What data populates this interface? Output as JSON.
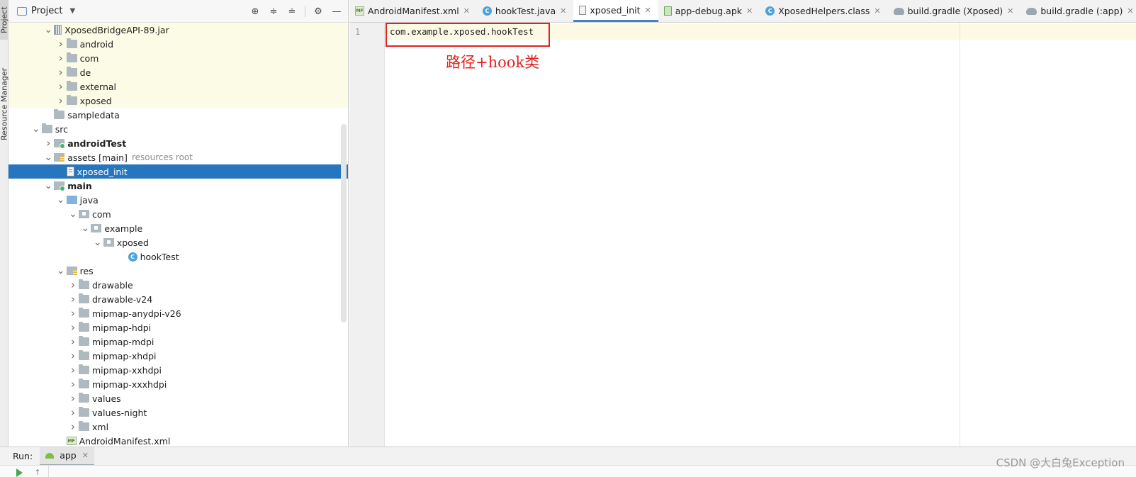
{
  "side_strip": {
    "project": "Project",
    "resource_manager": "Resource Manager"
  },
  "panel": {
    "title": "Project"
  },
  "tree": [
    {
      "label": "XposedBridgeAPI-89.jar",
      "depth": 3,
      "chevron": "down",
      "icon": "jar",
      "lib": true
    },
    {
      "label": "android",
      "depth": 4,
      "chevron": "right",
      "icon": "folder",
      "lib": true
    },
    {
      "label": "com",
      "depth": 4,
      "chevron": "right",
      "icon": "folder",
      "lib": true
    },
    {
      "label": "de",
      "depth": 4,
      "chevron": "right",
      "icon": "folder",
      "lib": true
    },
    {
      "label": "external",
      "depth": 4,
      "chevron": "right",
      "icon": "folder",
      "lib": true
    },
    {
      "label": "xposed",
      "depth": 4,
      "chevron": "right",
      "icon": "folder",
      "lib": true
    },
    {
      "label": "sampledata",
      "depth": 3,
      "chevron": "",
      "icon": "folder"
    },
    {
      "label": "src",
      "depth": 2,
      "chevron": "down",
      "icon": "folder"
    },
    {
      "label": "androidTest",
      "depth": 3,
      "chevron": "right",
      "icon": "folder-mod",
      "bold": true
    },
    {
      "label": "assets [main]",
      "depth": 3,
      "chevron": "down",
      "icon": "folder-res",
      "hint": "resources root"
    },
    {
      "label": "xposed_init",
      "depth": 4,
      "chevron": "",
      "icon": "file",
      "selected": true
    },
    {
      "label": "main",
      "depth": 3,
      "chevron": "down",
      "icon": "folder-mod",
      "bold": true
    },
    {
      "label": "java",
      "depth": 4,
      "chevron": "down",
      "icon": "folder-blue"
    },
    {
      "label": "com",
      "depth": 5,
      "chevron": "down",
      "icon": "folder-pkg"
    },
    {
      "label": "example",
      "depth": 6,
      "chevron": "down",
      "icon": "folder-pkg"
    },
    {
      "label": "xposed",
      "depth": 7,
      "chevron": "down",
      "icon": "folder-pkg"
    },
    {
      "label": "hookTest",
      "depth": 9,
      "chevron": "",
      "icon": "cls"
    },
    {
      "label": "res",
      "depth": 4,
      "chevron": "down",
      "icon": "folder-res"
    },
    {
      "label": "drawable",
      "depth": 5,
      "chevron": "right",
      "icon": "folder"
    },
    {
      "label": "drawable-v24",
      "depth": 5,
      "chevron": "right",
      "icon": "folder"
    },
    {
      "label": "mipmap-anydpi-v26",
      "depth": 5,
      "chevron": "right",
      "icon": "folder"
    },
    {
      "label": "mipmap-hdpi",
      "depth": 5,
      "chevron": "right",
      "icon": "folder"
    },
    {
      "label": "mipmap-mdpi",
      "depth": 5,
      "chevron": "right",
      "icon": "folder"
    },
    {
      "label": "mipmap-xhdpi",
      "depth": 5,
      "chevron": "right",
      "icon": "folder"
    },
    {
      "label": "mipmap-xxhdpi",
      "depth": 5,
      "chevron": "right",
      "icon": "folder"
    },
    {
      "label": "mipmap-xxxhdpi",
      "depth": 5,
      "chevron": "right",
      "icon": "folder"
    },
    {
      "label": "values",
      "depth": 5,
      "chevron": "right",
      "icon": "folder"
    },
    {
      "label": "values-night",
      "depth": 5,
      "chevron": "right",
      "icon": "folder"
    },
    {
      "label": "xml",
      "depth": 5,
      "chevron": "right",
      "icon": "folder"
    },
    {
      "label": "AndroidManifest.xml",
      "depth": 4,
      "chevron": "",
      "icon": "mf"
    }
  ],
  "tabs": [
    {
      "label": "AndroidManifest.xml",
      "icon": "mf"
    },
    {
      "label": "hookTest.java",
      "icon": "cls"
    },
    {
      "label": "xposed_init",
      "icon": "file",
      "active": true
    },
    {
      "label": "app-debug.apk",
      "icon": "apk"
    },
    {
      "label": "XposedHelpers.class",
      "icon": "cls"
    },
    {
      "label": "build.gradle (Xposed)",
      "icon": "gradle"
    },
    {
      "label": "build.gradle (:app)",
      "icon": "gradle"
    }
  ],
  "editor": {
    "line_number": "1",
    "code": "com.example.xposed.hookTest",
    "annotation": "路径+hook类"
  },
  "run": {
    "label": "Run:",
    "tab": "app"
  },
  "watermark": "CSDN @大白兔Exception",
  "colors": {
    "selection": "#2675bf",
    "annotation_red": "#e3211e",
    "active_tab_underline": "#4083c9"
  }
}
